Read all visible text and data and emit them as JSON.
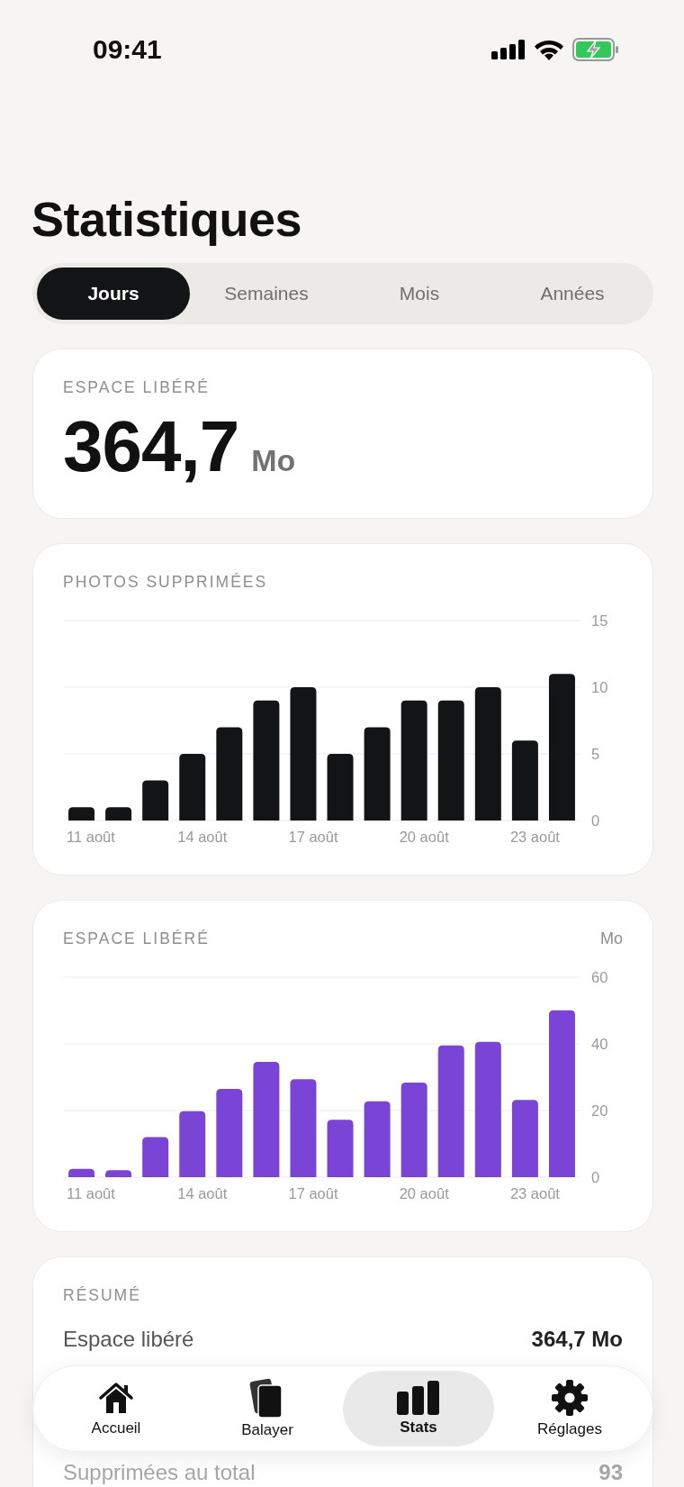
{
  "status_bar": {
    "time": "09:41"
  },
  "title": "Statistiques",
  "segments": [
    {
      "label": "Jours",
      "selected": true
    },
    {
      "label": "Semaines",
      "selected": false
    },
    {
      "label": "Mois",
      "selected": false
    },
    {
      "label": "Années",
      "selected": false
    }
  ],
  "space_card": {
    "label": "ESPACE LIBÉRÉ",
    "value": "364,7",
    "unit": "Mo"
  },
  "charts": [
    {
      "label": "PHOTOS SUPPRIMÉES",
      "chart_data": {
        "type": "bar",
        "categories": [
          "11 août",
          null,
          null,
          "14 août",
          null,
          null,
          "17 août",
          null,
          null,
          "20 août",
          null,
          null,
          "23 août",
          null
        ],
        "series": [
          {
            "color": "#131415",
            "values": [
              1,
              1,
              3,
              5,
              7,
              9,
              10,
              5,
              7,
              9,
              9,
              10,
              6,
              11
            ]
          }
        ],
        "ylim": [
          0,
          15
        ],
        "yticks": [
          0,
          5,
          10,
          15
        ]
      }
    },
    {
      "label": "ESPACE LIBÉRÉ",
      "chart_data": {
        "type": "bar",
        "ylabel": "Mo",
        "categories": [
          "11 août",
          null,
          null,
          "14 août",
          null,
          null,
          "17 août",
          null,
          null,
          "20 août",
          null,
          null,
          "23 août",
          null
        ],
        "series": [
          {
            "color": "#7a45d6",
            "values": [
              2.5,
              2.1,
              12,
              19.8,
              26.5,
              34.6,
              29.4,
              17.2,
              22.8,
              28.4,
              39.5,
              40.6,
              23.2,
              50.1
            ]
          }
        ],
        "ylim": [
          0,
          60
        ],
        "yticks": [
          0,
          20,
          40,
          60
        ]
      }
    }
  ],
  "summary": {
    "label": "RÉSUMÉ",
    "rows": [
      {
        "label": "Espace libéré",
        "value": "364,7 Mo",
        "faded": false
      },
      {
        "label": "Supprimées au total",
        "value": "93",
        "faded": true
      }
    ]
  },
  "tab_bar": [
    {
      "label": "Accueil",
      "selected": false
    },
    {
      "label": "Balayer",
      "selected": false
    },
    {
      "label": "Stats",
      "selected": true
    },
    {
      "label": "Réglages",
      "selected": false
    }
  ]
}
